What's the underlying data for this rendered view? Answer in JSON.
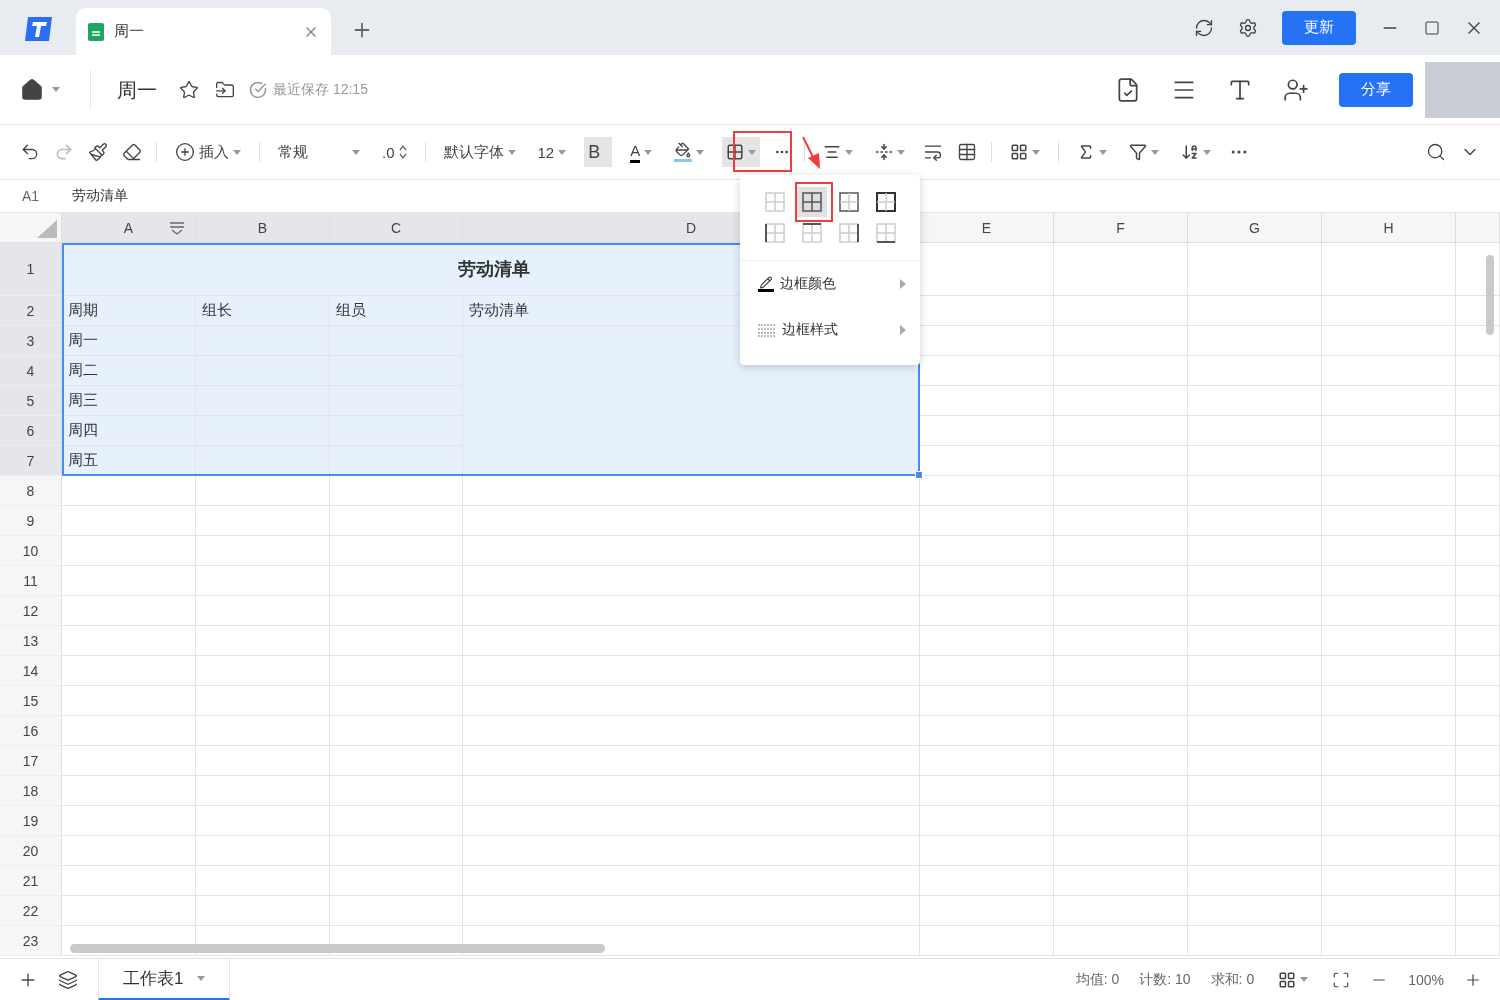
{
  "titlebar": {
    "tab": {
      "title": "周一",
      "selected": true
    },
    "update_button": "更新"
  },
  "header": {
    "doc_title": "周一",
    "save_status": "最近保存 12:15",
    "share_button": "分享"
  },
  "toolbar": {
    "redo_disabled": true,
    "insert": "插入",
    "number_format": "常规",
    "decimal": ".0",
    "font": "默认字体",
    "font_size": "12",
    "bold": {
      "label": "B",
      "active": true
    },
    "text_color": {
      "label": "A",
      "color": "#000000"
    },
    "fill_color": {
      "color": "#7fc8f0"
    },
    "border_open": true
  },
  "border_menu": {
    "presets": [
      {
        "selected": false
      },
      {
        "selected": true
      },
      {
        "selected": false
      },
      {
        "selected": false
      },
      {
        "selected": false
      },
      {
        "selected": false
      },
      {
        "selected": false
      },
      {
        "selected": false
      }
    ],
    "items": [
      {
        "label": "边框颜色"
      },
      {
        "label": "边框样式"
      }
    ]
  },
  "formula_bar": {
    "cell": "A1",
    "content": "劳动清单"
  },
  "sheet": {
    "columns": [
      {
        "label": "A",
        "selected": true
      },
      {
        "label": "B",
        "selected": true
      },
      {
        "label": "C",
        "selected": true
      },
      {
        "label": "D",
        "selected": true
      },
      {
        "label": "E",
        "selected": false
      },
      {
        "label": "F",
        "selected": false
      },
      {
        "label": "G",
        "selected": false
      },
      {
        "label": "H",
        "selected": false
      }
    ],
    "row_numbers": [
      {
        "label": "1",
        "selected": true
      },
      {
        "label": "2",
        "selected": true
      },
      {
        "label": "3",
        "selected": true
      },
      {
        "label": "4",
        "selected": true
      },
      {
        "label": "5",
        "selected": true
      },
      {
        "label": "6",
        "selected": true
      },
      {
        "label": "7",
        "selected": true
      },
      {
        "label": "8",
        "selected": false
      },
      {
        "label": "9",
        "selected": false
      },
      {
        "label": "10",
        "selected": false
      },
      {
        "label": "11",
        "selected": false
      },
      {
        "label": "12",
        "selected": false
      },
      {
        "label": "13",
        "selected": false
      },
      {
        "label": "14",
        "selected": false
      },
      {
        "label": "15",
        "selected": false
      },
      {
        "label": "16",
        "selected": false
      },
      {
        "label": "17",
        "selected": false
      },
      {
        "label": "18",
        "selected": false
      },
      {
        "label": "19",
        "selected": false
      },
      {
        "label": "20",
        "selected": false
      },
      {
        "label": "21",
        "selected": false
      },
      {
        "label": "22",
        "selected": false
      },
      {
        "label": "23",
        "selected": false
      }
    ],
    "title_cell": {
      "text": "劳动清单",
      "selected": true
    },
    "header_row": [
      {
        "text": "周期",
        "selected": true
      },
      {
        "text": "组长",
        "selected": true
      },
      {
        "text": "组员",
        "selected": true
      },
      {
        "text": "劳动清单",
        "selected": true
      }
    ],
    "day_rows": [
      {
        "text": "周一",
        "selected": true
      },
      {
        "text": "周二",
        "selected": true
      },
      {
        "text": "周三",
        "selected": true
      },
      {
        "text": "周四",
        "selected": true
      },
      {
        "text": "周五",
        "selected": true
      }
    ]
  },
  "status_bar": {
    "sheet_tab": {
      "label": "工作表1",
      "selected": true
    },
    "average": "均值: 0",
    "count": "计数: 10",
    "sum": "求和: 0",
    "zoom": "100%"
  }
}
